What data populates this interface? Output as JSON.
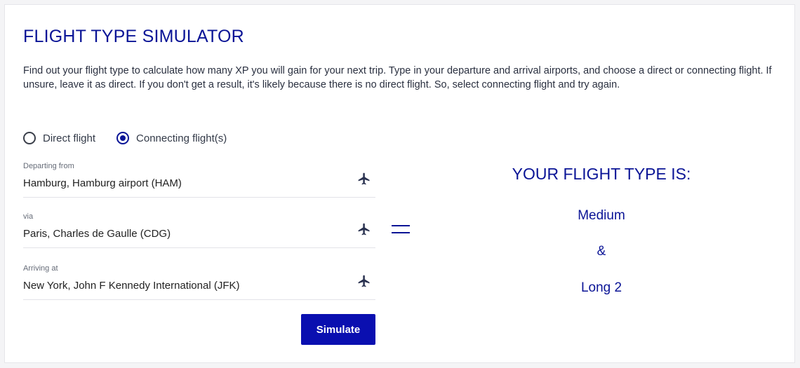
{
  "page": {
    "title": "FLIGHT TYPE SIMULATOR",
    "description": "Find out your flight type to calculate how many XP you will gain for your next trip. Type in your departure and arrival airports, and choose a direct or connecting flight. If unsure, leave it as direct. If you don't get a result, it's likely because there is no direct flight. So, select connecting flight and try again."
  },
  "options": {
    "direct": {
      "label": "Direct flight",
      "selected": false
    },
    "connecting": {
      "label": "Connecting flight(s)",
      "selected": true
    }
  },
  "fields": {
    "departing": {
      "label": "Departing from",
      "value": "Hamburg, Hamburg airport (HAM)",
      "icon": "plane-icon"
    },
    "via": {
      "label": "via",
      "value": "Paris, Charles de Gaulle (CDG)",
      "icon": "plane-icon"
    },
    "arriving": {
      "label": "Arriving at",
      "value": "New York, John F Kennedy International (JFK)",
      "icon": "plane-icon"
    }
  },
  "button": {
    "simulate_label": "Simulate"
  },
  "result": {
    "heading": "YOUR FLIGHT TYPE IS:",
    "line1": "Medium",
    "separator": "&",
    "line2": "Long 2"
  },
  "colors": {
    "accent": "#0a1496",
    "button": "#0a0fb0"
  }
}
